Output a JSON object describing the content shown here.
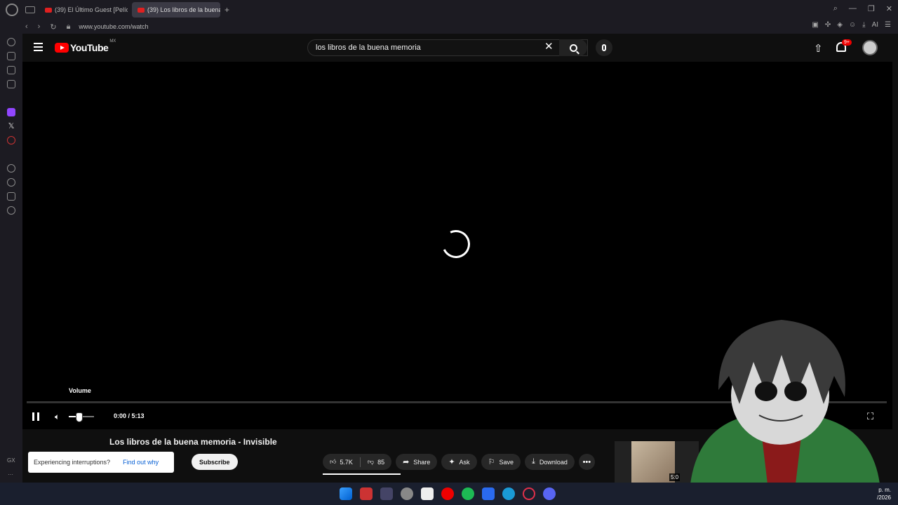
{
  "browser": {
    "tabs": [
      {
        "label": "(39) El Último Guest [Pelíc"
      },
      {
        "label": "(39) Los libros de la buena"
      }
    ],
    "new_tab_label": "+",
    "url": "www.youtube.com/watch",
    "ext_ai_label": "AI"
  },
  "youtube": {
    "logo_text": "YouTube",
    "country_code": "MX",
    "search_value": "los libros de la buena memoria",
    "notification_badge": "9+"
  },
  "player": {
    "volume_tooltip": "Volume",
    "time": "0:00 / 5:13",
    "progress_fraction": 0
  },
  "video": {
    "title": "Los libros de la buena memoria - Invisible",
    "toast_message": "Experiencing interruptions?",
    "toast_link": "Find out why",
    "subscribe_label": "Subscribe",
    "likes": "5.7K",
    "dislikes": "85",
    "share_label": "Share",
    "ask_label": "Ask",
    "save_label": "Save",
    "download_label": "Download",
    "more_label": "•••",
    "next_duration": "5:0"
  },
  "taskbar": {
    "clock_top": "p. m.",
    "clock_bottom": "/2026"
  },
  "sidebar": {
    "bottom_label": "GX",
    "more_label": "···"
  }
}
